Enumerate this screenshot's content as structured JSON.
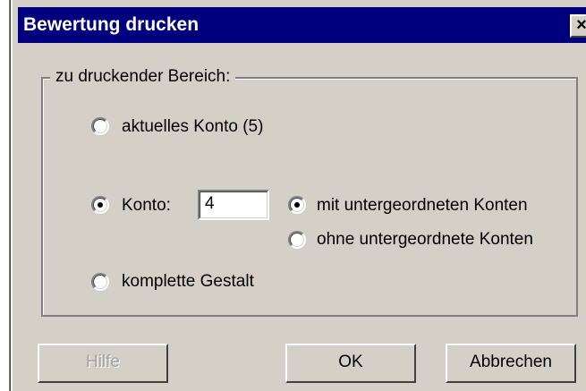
{
  "dialog": {
    "title": "Bewertung drucken",
    "close_symbol": "×",
    "group_label": "zu druckender Bereich:",
    "options": {
      "aktuelles_konto": {
        "label": "aktuelles Konto (5)",
        "checked": false
      },
      "konto": {
        "label": "Konto:",
        "checked": true,
        "value": "4"
      },
      "komplette_gestalt": {
        "label": "komplette Gestalt",
        "checked": false
      }
    },
    "sub_options": {
      "mit": {
        "label": "mit untergeordneten Konten",
        "checked": true
      },
      "ohne": {
        "label": "ohne untergeordnete Konten",
        "checked": false
      }
    },
    "buttons": {
      "help": "Hilfe",
      "ok": "OK",
      "cancel": "Abbrechen"
    },
    "colors": {
      "titlebar": "#00007f",
      "face": "#d4d0c8"
    }
  }
}
